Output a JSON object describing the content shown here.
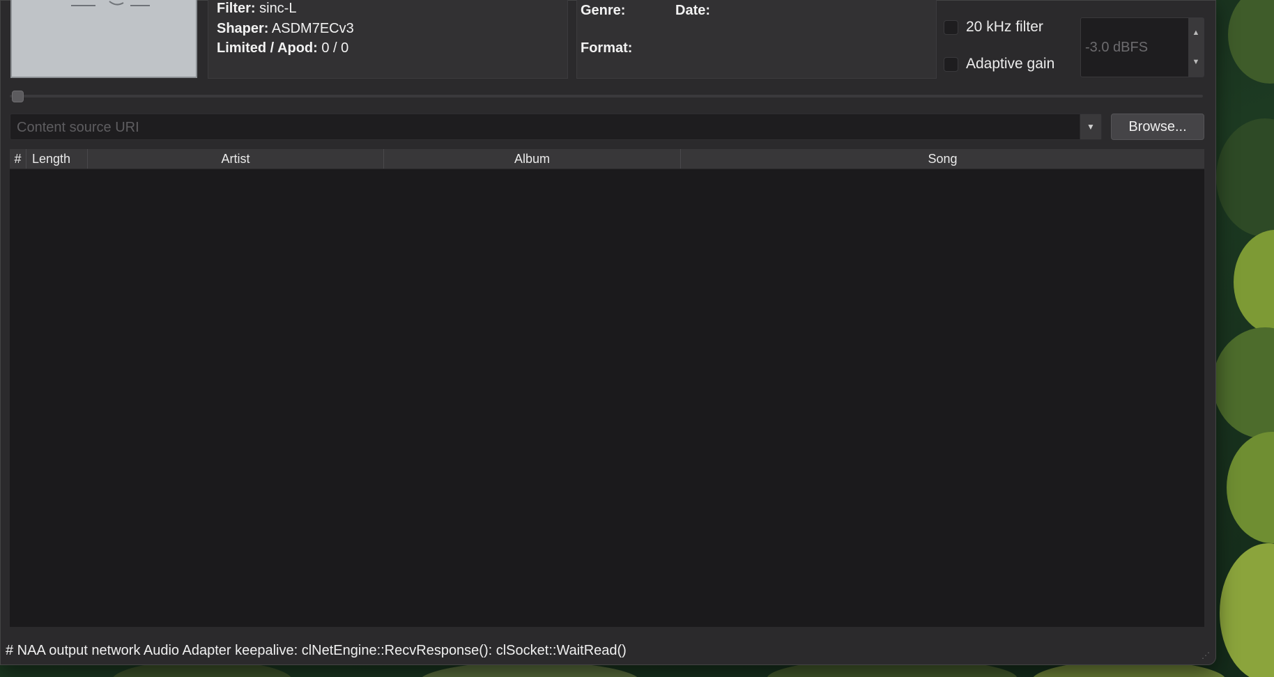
{
  "track_info": {
    "filter_label": "Filter:",
    "filter_value": " sinc-L",
    "shaper_label": "Shaper:",
    "shaper_value": " ASDM7ECv3",
    "limited_label": "Limited / Apod:",
    "limited_value": " 0 / 0"
  },
  "metadata": {
    "genre_label": "Genre:",
    "date_label": "Date:",
    "format_label": "Format:"
  },
  "options": {
    "filter_20khz_label": "20 kHz filter",
    "adaptive_gain_label": "Adaptive gain",
    "gain_value": "-3.0 dBFS"
  },
  "source": {
    "uri_placeholder": "Content source URI",
    "uri_value": "",
    "browse_label": "Browse..."
  },
  "playlist": {
    "columns": [
      "#",
      "Length",
      "Artist",
      "Album",
      "Song"
    ],
    "rows": []
  },
  "status_text": "# NAA output network Audio Adapter keepalive: clNetEngine::RecvResponse(): clSocket::WaitRead()",
  "icons": {
    "spin_up": "triangle-up-icon",
    "spin_down": "triangle-down-icon",
    "dropdown": "chevron-down-icon",
    "resize": "resize-grip-icon"
  }
}
